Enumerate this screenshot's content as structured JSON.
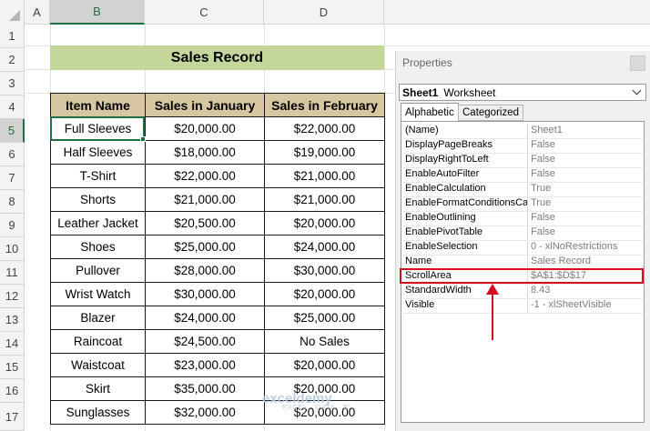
{
  "columns": [
    "A",
    "B",
    "C",
    "D"
  ],
  "rows": [
    "1",
    "2",
    "3",
    "4",
    "5",
    "6",
    "7",
    "8",
    "9",
    "10",
    "11",
    "12",
    "13",
    "14",
    "15",
    "16",
    "17"
  ],
  "title": "Sales Record",
  "table": {
    "headers": [
      "Item Name",
      "Sales in January",
      "Sales in February"
    ],
    "rows": [
      [
        "Full Sleeves",
        "$20,000.00",
        "$22,000.00"
      ],
      [
        "Half Sleeves",
        "$18,000.00",
        "$19,000.00"
      ],
      [
        "T-Shirt",
        "$22,000.00",
        "$21,000.00"
      ],
      [
        "Shorts",
        "$21,000.00",
        "$21,000.00"
      ],
      [
        "Leather Jacket",
        "$20,500.00",
        "$20,000.00"
      ],
      [
        "Shoes",
        "$25,000.00",
        "$24,000.00"
      ],
      [
        "Pullover",
        "$28,000.00",
        "$30,000.00"
      ],
      [
        "Wrist Watch",
        "$30,000.00",
        "$20,000.00"
      ],
      [
        "Blazer",
        "$24,000.00",
        "$25,000.00"
      ],
      [
        "Raincoat",
        "$24,500.00",
        "No Sales"
      ],
      [
        "Waistcoat",
        "$23,000.00",
        "$20,000.00"
      ],
      [
        "Skirt",
        "$35,000.00",
        "$20,000.00"
      ],
      [
        "Sunglasses",
        "$32,000.00",
        "$20,000.00"
      ]
    ]
  },
  "properties": {
    "title": "Properties",
    "object_name": "Sheet1",
    "object_type": "Worksheet",
    "tabs": [
      "Alphabetic",
      "Categorized"
    ],
    "items": [
      {
        "name": "(Name)",
        "value": "Sheet1"
      },
      {
        "name": "DisplayPageBreaks",
        "value": "False"
      },
      {
        "name": "DisplayRightToLeft",
        "value": "False"
      },
      {
        "name": "EnableAutoFilter",
        "value": "False"
      },
      {
        "name": "EnableCalculation",
        "value": "True"
      },
      {
        "name": "EnableFormatConditionsCalculation",
        "value": "True"
      },
      {
        "name": "EnableOutlining",
        "value": "False"
      },
      {
        "name": "EnablePivotTable",
        "value": "False"
      },
      {
        "name": "EnableSelection",
        "value": "0 - xlNoRestrictions"
      },
      {
        "name": "Name",
        "value": "Sales Record"
      },
      {
        "name": "ScrollArea",
        "value": "$A$1:$D$17"
      },
      {
        "name": "StandardWidth",
        "value": "8.43"
      },
      {
        "name": "Visible",
        "value": "-1 - xlSheetVisible"
      }
    ]
  },
  "watermark": {
    "brand": "exceldemy",
    "tagline": "EXCEL · DATA · BI"
  },
  "colors": {
    "title_fill": "#c4d79b",
    "header_fill": "#d6c7a0",
    "highlight": "#d40f1f",
    "selection": "#1e7145"
  }
}
